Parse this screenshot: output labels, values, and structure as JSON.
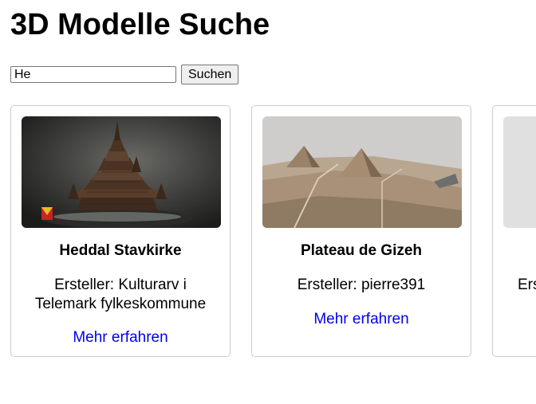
{
  "page": {
    "title": "3D Modelle Suche"
  },
  "search": {
    "value": "He",
    "button_label": "Suchen"
  },
  "cards": [
    {
      "title": "Heddal Stavkirke",
      "creator": "Ersteller: Kulturarv i Telemark fylkeskommune",
      "link_label": "Mehr erfahren",
      "thumbnail": "stave-church-image"
    },
    {
      "title": "Plateau de Gizeh",
      "creator": "Ersteller: pierre391",
      "link_label": "Mehr erfahren",
      "thumbnail": "pyramids-image"
    },
    {
      "title": "",
      "creator": "Ers",
      "link_label": "",
      "thumbnail": "placeholder-image"
    }
  ],
  "colors": {
    "link": "#0000ee",
    "card_border": "#cccccc"
  }
}
